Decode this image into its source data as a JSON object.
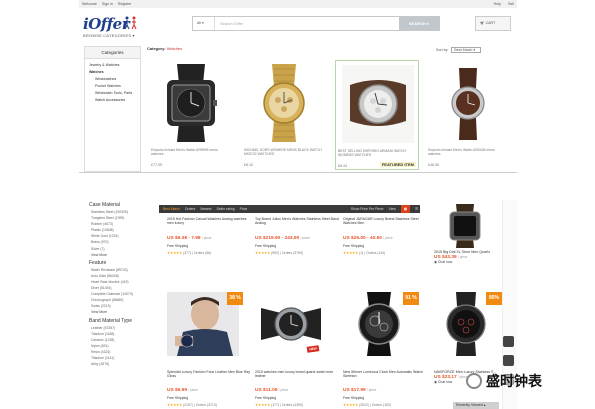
{
  "top_screenshot": {
    "topbar": {
      "welcome": "Welcome",
      "sign_in": "Sign in",
      "register": "Register",
      "help": "Help",
      "sell": "Sell"
    },
    "logo_text": "iOffer",
    "browse_label": "BROWSE CATEGORIES",
    "search": {
      "category": "All",
      "placeholder": "Search iOffer",
      "button": "SEARCH"
    },
    "cart_label": "CART",
    "sidebar": {
      "title": "Categories",
      "items": [
        {
          "label": "Jewelry & Watches",
          "level": 0,
          "selected": false
        },
        {
          "label": "Watches",
          "level": 0,
          "selected": true
        },
        {
          "label": "Wristwatches",
          "level": 1,
          "selected": false
        },
        {
          "label": "Pocket Watches",
          "level": 1,
          "selected": false
        },
        {
          "label": "Wristwatch Tools, Parts",
          "level": 1,
          "selected": false
        },
        {
          "label": "Watch Accessories",
          "level": 1,
          "selected": false
        }
      ]
    },
    "category_prefix": "Category:",
    "category_value": "Watches",
    "sort": {
      "label": "Sort by:",
      "value": "Best Match"
    },
    "products": [
      {
        "name": "Emporio Armani Men's Watch AR5905 mens watches",
        "price": "£77.05",
        "featured": false
      },
      {
        "name": "MICHAEL KORS WOMENS MENS BLACK WATCH MK5722 WATCHES",
        "price": "£8.10",
        "featured": false
      },
      {
        "name": "BEST SELLING EMPORIO ARMANI WATCH WOMENS WATCHES",
        "price": "£8.43",
        "featured": true,
        "featured_label": "FEATURED ITEM"
      },
      {
        "name": "Emporio Armani Men's Watch AR0428 mens watches",
        "price": "£46.06",
        "featured": false
      }
    ]
  },
  "bottom_screenshot": {
    "filters": [
      {
        "header": "Case Material",
        "items": [
          "Stainless Steel (100309)",
          "Tungsten Steel (1399)",
          "Rubber (4673)",
          "Plastic (10848)",
          "White Gold (1024)",
          "Brass (970)",
          "Silver (7)"
        ],
        "more": "View More"
      },
      {
        "header": "Feature",
        "items": [
          "Water Resistant (89743)",
          "Auto Date (86348)",
          "Heart Rate Monitor (419)",
          "Diver (51491)",
          "Complete Calendar (14073)",
          "Chronograph (56660)",
          "Swiss (2213)"
        ],
        "more": "View More"
      },
      {
        "header": "Band Material Type",
        "items": [
          "Leather (67357)",
          "Titanium (1188)",
          "Ceramic (1238)",
          "Nylon (831)",
          "Resin (4324)",
          "Titanium (1141)",
          "Alloy (2876)"
        ],
        "more": ""
      }
    ],
    "toolbar": {
      "items": [
        "Best Match",
        "Orders",
        "Newest",
        "Seller rating",
        "Price"
      ],
      "price_filter": "Show Price Per Piece",
      "view_label": "View"
    },
    "products": [
      {
        "title": "2015 Hot Fashion Casual Watches Analog watches men luxury",
        "price": "US $6.38 - 7.98",
        "unit": "/ piece",
        "shipping": "Free Shipping",
        "rating": "★★★★★",
        "orders": "(377) | Orders (66)",
        "discount": ""
      },
      {
        "title": "Top Brand Julius Men's Watches Stainless Steel Band Analog",
        "price": "US $219.90 - 243.90",
        "unit": "/ piece",
        "shipping": "Free Shipping",
        "rating": "★★★★★",
        "orders": "(992) | Orders (3769)",
        "discount": ""
      },
      {
        "title": "Original JARAGAR Luxury Brand Stainless Steel Watches Men",
        "price": "US $26.00 - 40.60",
        "unit": "/ piece",
        "shipping": "Free Shipping",
        "rating": "★★★★★",
        "orders": "(1) | Orders (144)",
        "discount": ""
      },
      {
        "title": "Splendid Luxury Fashion Faux Leather Men Blue Ray Gloss",
        "price": "US $6.99",
        "unit": "/ piece",
        "shipping": "Free Shipping",
        "rating": "★★★★★",
        "orders": "(2157) | Orders (3713)",
        "discount": "38 %"
      },
      {
        "title": "2015 watches men luxury brand quartz watch men leather",
        "price": "US $11.09",
        "unit": "/ piece",
        "shipping": "Free Shipping",
        "rating": "★★★★★",
        "orders": "(177) | Orders (4390)",
        "discount": ""
      },
      {
        "title": "New Winner Luminous Clock Men Automatic Watch Skeleton",
        "price": "US $17.99",
        "unit": "/ piece",
        "shipping": "Free Shipping",
        "rating": "★★★★★",
        "orders": "(3022) | Orders (150)",
        "discount": "91 %"
      }
    ],
    "new_badge": "NEW",
    "right_column": [
      {
        "title": "2015 Big Dial XL Store Men Quartz",
        "price": "US $43.39",
        "unit": "/ piece",
        "orders": "Chat now"
      },
      {
        "title": "NAVIFORCE Men Luxury Stainless S...",
        "price": "US $23.17",
        "unit": "/ piece",
        "orders": "Chat now",
        "discount": "80%"
      }
    ],
    "recently_viewed": "Recently Viewed"
  },
  "watermark": "盛时钟表",
  "colors": {
    "ioffer_blue": "#1f3f8a",
    "aliexpress_orange": "#e9562b",
    "badge_orange": "#f08a10",
    "toolbar_dark": "#3a3a3a"
  }
}
